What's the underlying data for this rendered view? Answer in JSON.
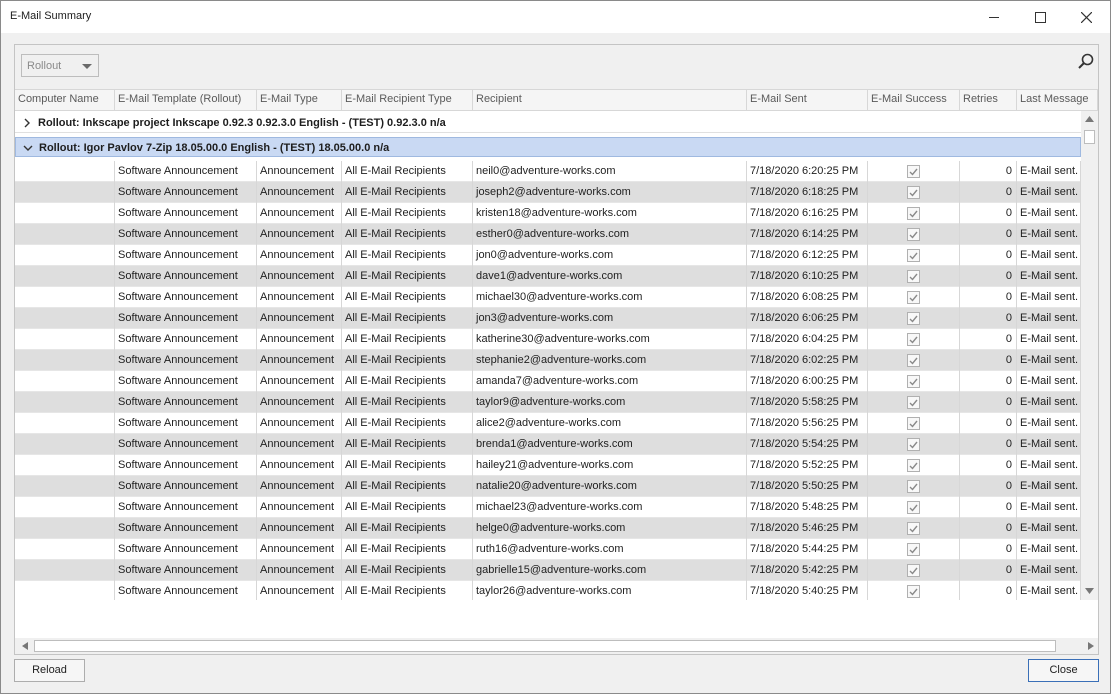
{
  "window": {
    "title": "E-Mail Summary"
  },
  "toolbar": {
    "group_select": "Rollout"
  },
  "columns": [
    "Computer Name",
    "E-Mail Template (Rollout)",
    "E-Mail Type",
    "E-Mail Recipient Type",
    "Recipient",
    "E-Mail Sent",
    "E-Mail Success",
    "Retries",
    "Last Message"
  ],
  "groups": [
    {
      "label": "Rollout: Inkscape project Inkscape 0.92.3 0.92.3.0 English - (TEST) 0.92.3.0 n/a",
      "expanded": false
    },
    {
      "label": "Rollout: Igor Pavlov 7-Zip 18.05.00.0 English - (TEST) 18.05.00.0 n/a",
      "expanded": true
    }
  ],
  "rows": [
    {
      "computer": "",
      "template": "Software Announcement",
      "type": "Announcement",
      "recipient_type": "All E-Mail Recipients",
      "recipient": "neil0@adventure-works.com",
      "sent": "7/18/2020 6:20:25 PM",
      "success": true,
      "retries": "0",
      "message": "E-Mail sent."
    },
    {
      "computer": "",
      "template": "Software Announcement",
      "type": "Announcement",
      "recipient_type": "All E-Mail Recipients",
      "recipient": "joseph2@adventure-works.com",
      "sent": "7/18/2020 6:18:25 PM",
      "success": true,
      "retries": "0",
      "message": "E-Mail sent."
    },
    {
      "computer": "",
      "template": "Software Announcement",
      "type": "Announcement",
      "recipient_type": "All E-Mail Recipients",
      "recipient": "kristen18@adventure-works.com",
      "sent": "7/18/2020 6:16:25 PM",
      "success": true,
      "retries": "0",
      "message": "E-Mail sent."
    },
    {
      "computer": "",
      "template": "Software Announcement",
      "type": "Announcement",
      "recipient_type": "All E-Mail Recipients",
      "recipient": "esther0@adventure-works.com",
      "sent": "7/18/2020 6:14:25 PM",
      "success": true,
      "retries": "0",
      "message": "E-Mail sent."
    },
    {
      "computer": "",
      "template": "Software Announcement",
      "type": "Announcement",
      "recipient_type": "All E-Mail Recipients",
      "recipient": "jon0@adventure-works.com",
      "sent": "7/18/2020 6:12:25 PM",
      "success": true,
      "retries": "0",
      "message": "E-Mail sent."
    },
    {
      "computer": "",
      "template": "Software Announcement",
      "type": "Announcement",
      "recipient_type": "All E-Mail Recipients",
      "recipient": "dave1@adventure-works.com",
      "sent": "7/18/2020 6:10:25 PM",
      "success": true,
      "retries": "0",
      "message": "E-Mail sent."
    },
    {
      "computer": "",
      "template": "Software Announcement",
      "type": "Announcement",
      "recipient_type": "All E-Mail Recipients",
      "recipient": "michael30@adventure-works.com",
      "sent": "7/18/2020 6:08:25 PM",
      "success": true,
      "retries": "0",
      "message": "E-Mail sent."
    },
    {
      "computer": "",
      "template": "Software Announcement",
      "type": "Announcement",
      "recipient_type": "All E-Mail Recipients",
      "recipient": "jon3@adventure-works.com",
      "sent": "7/18/2020 6:06:25 PM",
      "success": true,
      "retries": "0",
      "message": "E-Mail sent."
    },
    {
      "computer": "",
      "template": "Software Announcement",
      "type": "Announcement",
      "recipient_type": "All E-Mail Recipients",
      "recipient": "katherine30@adventure-works.com",
      "sent": "7/18/2020 6:04:25 PM",
      "success": true,
      "retries": "0",
      "message": "E-Mail sent."
    },
    {
      "computer": "",
      "template": "Software Announcement",
      "type": "Announcement",
      "recipient_type": "All E-Mail Recipients",
      "recipient": "stephanie2@adventure-works.com",
      "sent": "7/18/2020 6:02:25 PM",
      "success": true,
      "retries": "0",
      "message": "E-Mail sent."
    },
    {
      "computer": "",
      "template": "Software Announcement",
      "type": "Announcement",
      "recipient_type": "All E-Mail Recipients",
      "recipient": "amanda7@adventure-works.com",
      "sent": "7/18/2020 6:00:25 PM",
      "success": true,
      "retries": "0",
      "message": "E-Mail sent."
    },
    {
      "computer": "",
      "template": "Software Announcement",
      "type": "Announcement",
      "recipient_type": "All E-Mail Recipients",
      "recipient": "taylor9@adventure-works.com",
      "sent": "7/18/2020 5:58:25 PM",
      "success": true,
      "retries": "0",
      "message": "E-Mail sent."
    },
    {
      "computer": "",
      "template": "Software Announcement",
      "type": "Announcement",
      "recipient_type": "All E-Mail Recipients",
      "recipient": "alice2@adventure-works.com",
      "sent": "7/18/2020 5:56:25 PM",
      "success": true,
      "retries": "0",
      "message": "E-Mail sent."
    },
    {
      "computer": "",
      "template": "Software Announcement",
      "type": "Announcement",
      "recipient_type": "All E-Mail Recipients",
      "recipient": "brenda1@adventure-works.com",
      "sent": "7/18/2020 5:54:25 PM",
      "success": true,
      "retries": "0",
      "message": "E-Mail sent."
    },
    {
      "computer": "",
      "template": "Software Announcement",
      "type": "Announcement",
      "recipient_type": "All E-Mail Recipients",
      "recipient": "hailey21@adventure-works.com",
      "sent": "7/18/2020 5:52:25 PM",
      "success": true,
      "retries": "0",
      "message": "E-Mail sent."
    },
    {
      "computer": "",
      "template": "Software Announcement",
      "type": "Announcement",
      "recipient_type": "All E-Mail Recipients",
      "recipient": "natalie20@adventure-works.com",
      "sent": "7/18/2020 5:50:25 PM",
      "success": true,
      "retries": "0",
      "message": "E-Mail sent."
    },
    {
      "computer": "",
      "template": "Software Announcement",
      "type": "Announcement",
      "recipient_type": "All E-Mail Recipients",
      "recipient": "michael23@adventure-works.com",
      "sent": "7/18/2020 5:48:25 PM",
      "success": true,
      "retries": "0",
      "message": "E-Mail sent."
    },
    {
      "computer": "",
      "template": "Software Announcement",
      "type": "Announcement",
      "recipient_type": "All E-Mail Recipients",
      "recipient": "helge0@adventure-works.com",
      "sent": "7/18/2020 5:46:25 PM",
      "success": true,
      "retries": "0",
      "message": "E-Mail sent."
    },
    {
      "computer": "",
      "template": "Software Announcement",
      "type": "Announcement",
      "recipient_type": "All E-Mail Recipients",
      "recipient": "ruth16@adventure-works.com",
      "sent": "7/18/2020 5:44:25 PM",
      "success": true,
      "retries": "0",
      "message": "E-Mail sent."
    },
    {
      "computer": "",
      "template": "Software Announcement",
      "type": "Announcement",
      "recipient_type": "All E-Mail Recipients",
      "recipient": "gabrielle15@adventure-works.com",
      "sent": "7/18/2020 5:42:25 PM",
      "success": true,
      "retries": "0",
      "message": "E-Mail sent."
    },
    {
      "computer": "",
      "template": "Software Announcement",
      "type": "Announcement",
      "recipient_type": "All E-Mail Recipients",
      "recipient": "taylor26@adventure-works.com",
      "sent": "7/18/2020 5:40:25 PM",
      "success": true,
      "retries": "0",
      "message": "E-Mail sent."
    }
  ],
  "footer": {
    "reload_label": "Reload",
    "close_label": "Close"
  },
  "colors": {
    "selected_group": "#c9d9f3",
    "alt_row": "#dedede",
    "close_border": "#3a6fb7"
  },
  "icons": {
    "minimize": "minimize-icon",
    "maximize": "maximize-icon",
    "close": "close-icon",
    "search": "search-icon",
    "collapsed": "chevron-right-icon",
    "expanded": "chevron-down-icon",
    "checkbox": "checkmark-icon"
  }
}
